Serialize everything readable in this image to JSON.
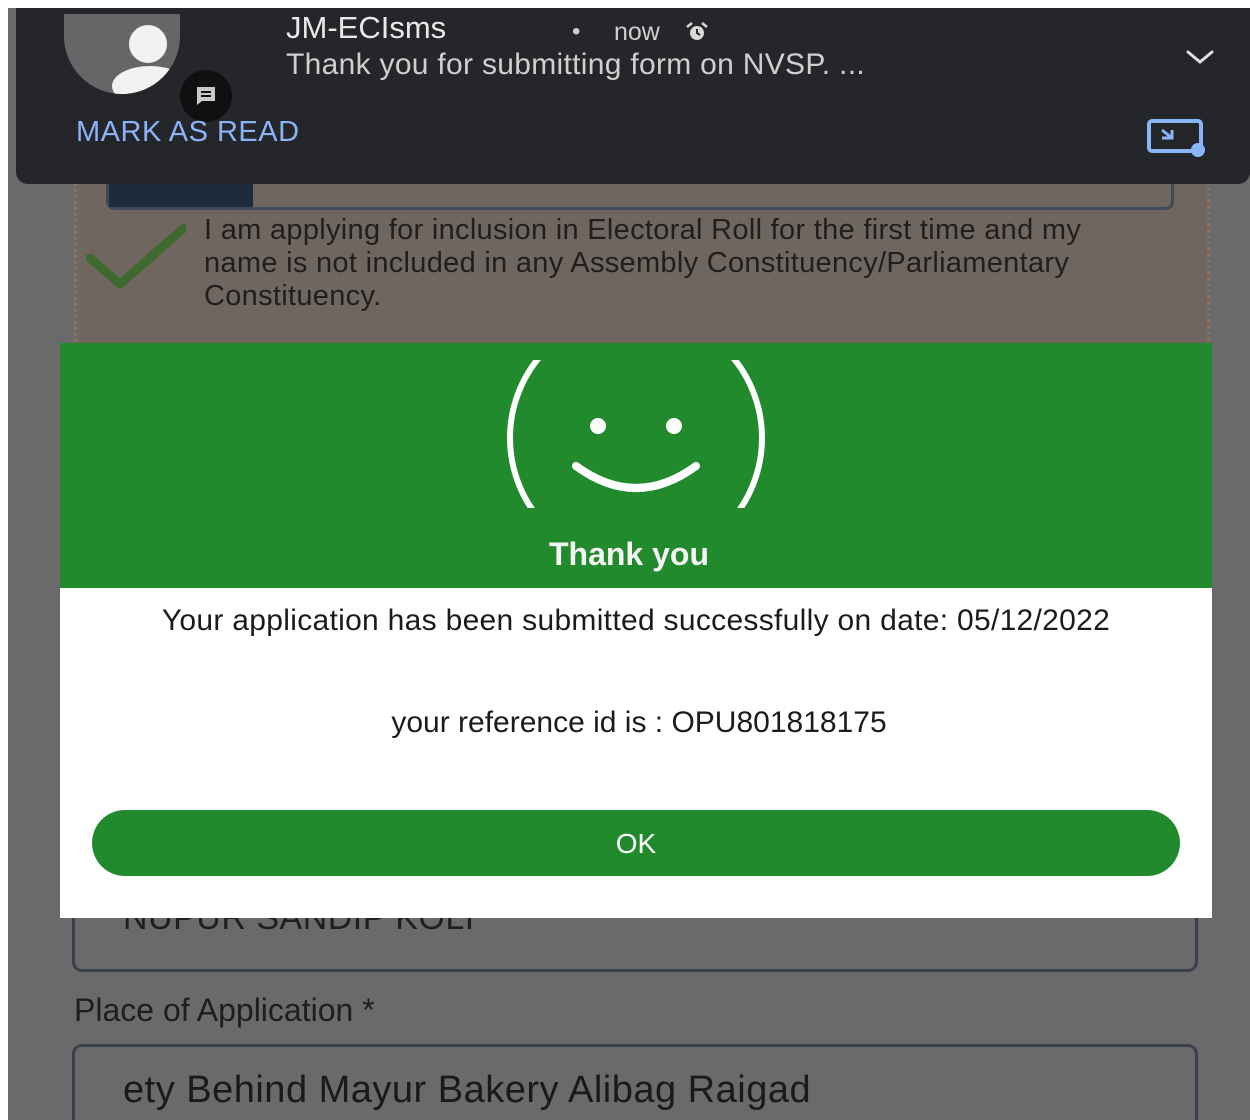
{
  "notification": {
    "sender": "JM-ECIsms",
    "separator": "•",
    "time": "now",
    "preview": "Thank you for submitting form on NVSP. ...",
    "action_label": "MARK AS READ",
    "icons": [
      "avatar-person-icon",
      "message-badge-icon",
      "alarm-icon",
      "chevron-down-icon",
      "picture-in-picture-icon"
    ]
  },
  "form": {
    "declaration_text": "I am applying for inclusion in Electoral Roll for the first time and my name is not included in any Assembly Constituency/Parliamentary Constituency.",
    "name_value": "NUPUR SANDIP KOLI",
    "place_label": "Place of Application *",
    "place_value": "ety Behind Mayur Bakery Alibag Raigad"
  },
  "dialog": {
    "title": "Thank you",
    "message": "Your application has been submitted successfully on date: 05/12/2022",
    "reference": "your reference id is : OPU801818175",
    "ok_label": "OK",
    "icon": "smiley-face-icon"
  },
  "colors": {
    "accent_green": "#218a2c",
    "notification_bg": "#252629",
    "link_blue": "#8ab4f8"
  }
}
